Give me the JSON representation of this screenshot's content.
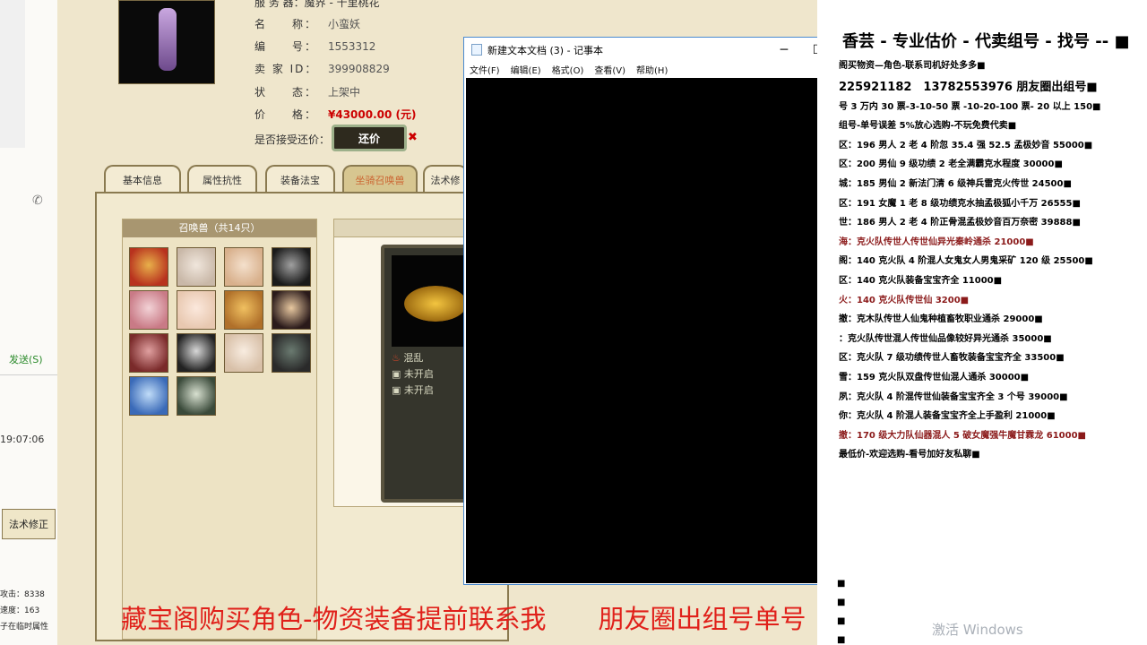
{
  "chat": {
    "send_label": "发送(S)",
    "time": "19:07:06",
    "skill_button": "法术修正",
    "stats": [
      "攻击：8338",
      "速度：163",
      "子在临时属性"
    ]
  },
  "game": {
    "server_label": "服 务 器：魔界 - 千里桃花",
    "fields": [
      {
        "key": "名　　称：",
        "value": "小蛮妖"
      },
      {
        "key": "编　　号：",
        "value": "1553312"
      },
      {
        "key": "卖 家 ID：",
        "value": "399908829"
      },
      {
        "key": "状　　态：",
        "value": "上架中"
      },
      {
        "key": "价　　格：",
        "value": "¥43000.00 (元)"
      }
    ],
    "bargain_question": "是否接受还价：",
    "bargain_button": "还价",
    "tabs": [
      "基本信息",
      "属性抗性",
      "装备法宝",
      "坐骑召唤兽",
      "法术修"
    ],
    "active_tab": 3,
    "pet_panel_title": "召唤兽（共14只）",
    "pet_count": 14,
    "skills": [
      "混乱",
      "未开启",
      "未开启"
    ]
  },
  "notepad": {
    "title": "新建文本文档 (3) - 记事本",
    "menu": [
      "文件(F)",
      "编辑(E)",
      "格式(O)",
      "查看(V)",
      "帮助(H)"
    ],
    "minimize": "─",
    "maximize": "☐",
    "close": "✕"
  },
  "ad": {
    "headline": "香芸 - 专业估价 - 代卖组号 - 找号 -- ■",
    "lines": [
      {
        "text": "阁买物资—角色-联系司机好处多多■",
        "color": "#000"
      },
      {
        "text": "225921182　13782553976 朋友圈出组号■",
        "color": "#000",
        "big": true
      },
      {
        "text": "号 3 万内 30 票-3-10-50 票 -10-20-100 票- 20 以上 150■",
        "color": "#000"
      },
      {
        "text": "组号-单号误差 5%放心选购-不玩免费代卖■",
        "color": "#000"
      },
      {
        "text": "区：196 男人 2 老 4 阶忽 35.4 强 52.5 孟极妙音 55000■",
        "color": "#000"
      },
      {
        "text": "区：200 男仙 9 级功绩 2 老全满霸克水程度 30000■",
        "color": "#000"
      },
      {
        "text": "城：185 男仙 2 新法门清 6 级神兵雷克火传世 24500■",
        "color": "#000"
      },
      {
        "text": "区：191 女魔 1 老 8 级功绩克水抽孟极狐小千万 26555■",
        "color": "#000"
      },
      {
        "text": "世：186 男人 2 老 4 阶正骨混孟极妙音百万奈密 39888■",
        "color": "#000"
      },
      {
        "text": "海：克火队传世人传世仙异光秦岭通杀 21000■",
        "color": "#8b1a1a"
      },
      {
        "text": "阁：140 克火队 4 阶混人女鬼女人男鬼采矿 120 级 25500■",
        "color": "#000"
      },
      {
        "text": "区：140 克火队装备宝宝齐全 11000■",
        "color": "#000"
      },
      {
        "text": "火：140 克火队传世仙 3200■",
        "color": "#8b1a1a"
      },
      {
        "text": "撤：克木队传世人仙鬼种植畜牧职业通杀 29000■",
        "color": "#000"
      },
      {
        "text": "：克火队传世混人传世仙品像较好异光通杀 35000■",
        "color": "#000"
      },
      {
        "text": "区：克火队 7 级功绩传世人畜牧装备宝宝齐全 33500■",
        "color": "#000"
      },
      {
        "text": "雪：159 克火队双盘传世仙混人通杀 30000■",
        "color": "#000"
      },
      {
        "text": "夙：克火队 4 阶混传世仙装备宝宝齐全 3 个号 39000■",
        "color": "#000"
      },
      {
        "text": "你：克火队 4 阶混人装备宝宝齐全上手盈利 21000■",
        "color": "#000"
      },
      {
        "text": "撤：170 级大力队仙器混人 5 破女魔强牛魔甘霖龙 61000■",
        "color": "#8b1a1a"
      },
      {
        "text": "最低价-欢迎选购-看号加好友私聊■",
        "color": "#000"
      }
    ],
    "trailing": [
      "■",
      "■",
      "■",
      "■"
    ]
  },
  "overlay": {
    "caption": "藏宝阁购买角色-物资装备提前联系我　　朋友圈出组号单号",
    "watermark": "激活 Windows"
  }
}
